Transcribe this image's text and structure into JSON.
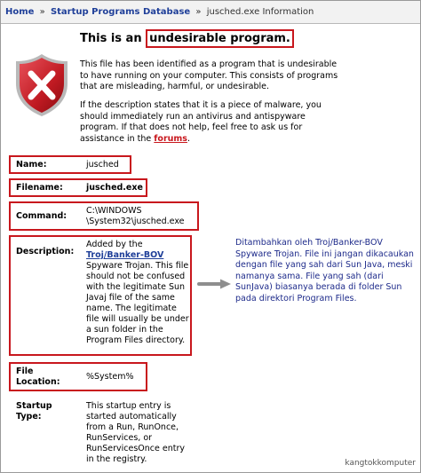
{
  "breadcrumb": {
    "home": "Home",
    "sep1": "»",
    "database": "Startup Programs Database",
    "sep2": "»",
    "current": "jusched.exe Information"
  },
  "header": {
    "prefix": "This is an ",
    "highlight": "undesirable program."
  },
  "intro": {
    "paragraph1": "This file has been identified as a program that is undesirable to have running on your computer. This consists of programs that are misleading, harmful, or undesirable.",
    "paragraph2": "If the description states that it is a piece of malware, you should immediately run an antivirus and antispyware program. If that does not help, feel free to ask us for assistance in the",
    "forums_link": "forums",
    "period": "."
  },
  "details": {
    "name_label": "Name:",
    "name_value": "jusched",
    "filename_label": "Filename:",
    "filename_value": "jusched.exe",
    "command_label": "Command:",
    "command_line1": "C:\\WINDOWS",
    "command_line2": "\\System32\\jusched.exe",
    "description_label": "Description:",
    "description_prefix": "Added by the",
    "description_link": "Troj/Banker-BOV",
    "description_rest": "Spyware Trojan. This file should not be confused with the legitimate Sun Javaj file of the same name. The legitimate file will usually be under a sun folder in the Program Files directory.",
    "file_label_line1": "File",
    "file_label_line2": "Location:",
    "location_value": "%System%",
    "startup_label_line1": "Startup",
    "startup_label_line2": "Type:",
    "startup_value": "This startup entry is started automatically from a Run, RunOnce, RunServices, or RunServicesOnce entry in the registry."
  },
  "annotation": {
    "text": "Ditambahkan oleh Troj/Banker-BOV Spyware Trojan. File ini jangan dikacaukan dengan file yang sah dari Sun Java, meski namanya sama. File yang sah (dari SunJava) biasanya berada di folder Sun pada direktori Program Files."
  },
  "watermark": "kangtokkomputer",
  "colors": {
    "highlight_border": "#c8171d",
    "link_blue": "#1f3f99",
    "annotation_blue": "#1d2a8a"
  },
  "icons": {
    "warning": "shield-x-icon",
    "arrow": "arrow-right-icon"
  }
}
